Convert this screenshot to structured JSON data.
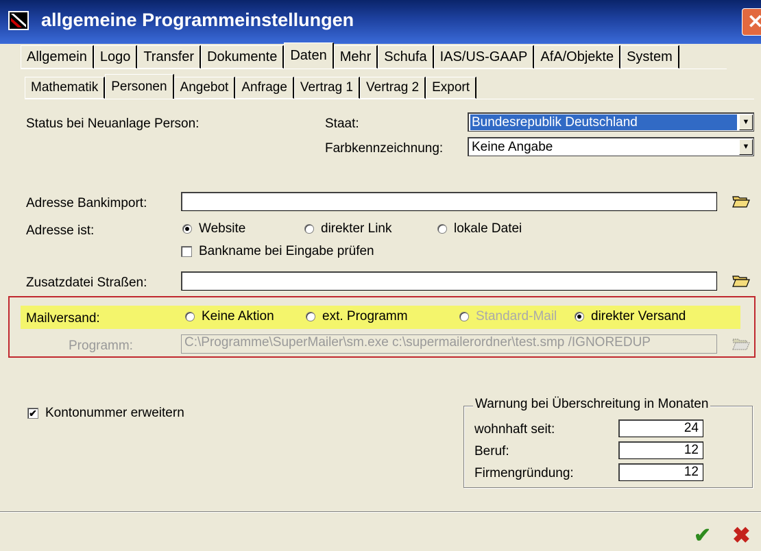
{
  "window": {
    "title": "allgemeine Programmeinstellungen",
    "close_glyph": "✕"
  },
  "top_tabs": [
    "Allgemein",
    "Logo",
    "Transfer",
    "Dokumente",
    "Daten",
    "Mehr",
    "Schufa",
    "IAS/US-GAAP",
    "AfA/Objekte",
    "System"
  ],
  "top_tab_selected": "Daten",
  "sub_tabs": [
    "Mathematik",
    "Personen",
    "Angebot",
    "Anfrage",
    "Vertrag 1",
    "Vertrag 2",
    "Export"
  ],
  "sub_tab_selected": "Personen",
  "status": {
    "label": "Status bei Neuanlage Person:",
    "staat_label": "Staat:",
    "staat_value": "Bundesrepublik Deutschland",
    "farb_label": "Farbkennzeichnung:",
    "farb_value": "Keine Angabe"
  },
  "bankimport": {
    "label": "Adresse Bankimport:",
    "value": "",
    "adresse_ist_label": "Adresse ist:",
    "options": [
      "Website",
      "direkter Link",
      "lokale Datei"
    ],
    "selected": "Website",
    "check_label": "Bankname bei Eingabe prüfen",
    "check_value": false
  },
  "zusatzdatei": {
    "label": "Zusatzdatei Straßen:",
    "value": ""
  },
  "mailversand": {
    "label": "Mailversand:",
    "options": [
      "Keine Aktion",
      "ext. Programm",
      "Standard-Mail",
      "direkter Versand"
    ],
    "disabled_option": "Standard-Mail",
    "selected": "direkter Versand",
    "programm_label": "Programm:",
    "programm_value": "C:\\Programme\\SuperMailer\\sm.exe c:\\supermailerordner\\test.smp /IGNOREDUP"
  },
  "kontonummer": {
    "label": "Kontonummer erweitern",
    "checked": true
  },
  "warnung": {
    "title": "Warnung bei Überschreitung in Monaten",
    "rows": [
      {
        "label": "wohnhaft seit:",
        "value": "24"
      },
      {
        "label": "Beruf:",
        "value": "12"
      },
      {
        "label": "Firmengründung:",
        "value": "12"
      }
    ]
  },
  "buttons": {
    "ok": "✔",
    "cancel": "✖"
  },
  "colors": {
    "titlebar": "#0a246a",
    "highlight": "#f4f56c",
    "frame": "#c0282e",
    "selection": "#316ac5"
  }
}
